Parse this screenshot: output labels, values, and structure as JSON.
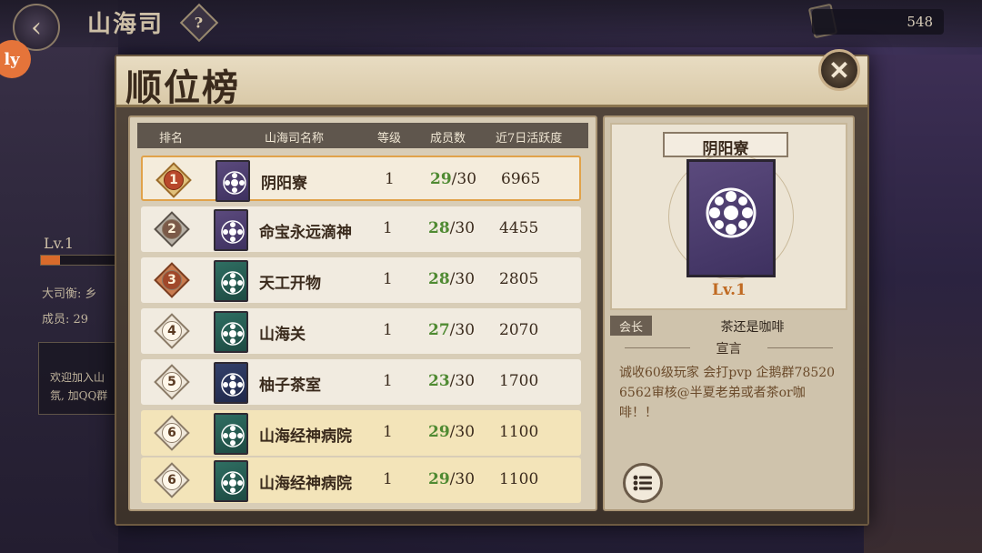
{
  "top_bar": {
    "title": "山海司",
    "help_symbol": "?",
    "currency_value": "548",
    "side_badge": "ly"
  },
  "background_info": {
    "level": "Lv.1",
    "level_progress": 0.25,
    "line1": "大司衡: 乡",
    "line2": "成员: 29",
    "welcome": "欢迎加入山 氛, 加QQ群"
  },
  "window": {
    "title": "顺位榜",
    "close_symbol": "✕"
  },
  "table": {
    "headers": [
      "排名",
      "山海司名称",
      "等级",
      "成员数",
      "近7日活跃度"
    ],
    "rows": [
      {
        "rank": "1",
        "name": "阴阳寮",
        "level": "1",
        "members_current": "29",
        "members_max": "/30",
        "activity": "6965",
        "emblem": "purple"
      },
      {
        "rank": "2",
        "name": "命宝永远滴神",
        "level": "1",
        "members_current": "28",
        "members_max": "/30",
        "activity": "4455",
        "emblem": "purple"
      },
      {
        "rank": "3",
        "name": "天工开物",
        "level": "1",
        "members_current": "28",
        "members_max": "/30",
        "activity": "2805",
        "emblem": "green"
      },
      {
        "rank": "4",
        "name": "山海关",
        "level": "1",
        "members_current": "27",
        "members_max": "/30",
        "activity": "2070",
        "emblem": "green"
      },
      {
        "rank": "5",
        "name": "柚子茶室",
        "level": "1",
        "members_current": "23",
        "members_max": "/30",
        "activity": "1700",
        "emblem": "navy"
      },
      {
        "rank": "6",
        "name": "山海经神病院",
        "level": "1",
        "members_current": "29",
        "members_max": "/30",
        "activity": "1100",
        "emblem": "green"
      },
      {
        "rank": "6",
        "name": "山海经神病院",
        "level": "1",
        "members_current": "29",
        "members_max": "/30",
        "activity": "1100",
        "emblem": "green"
      }
    ]
  },
  "detail": {
    "name": "阴阳寮",
    "level": "Lv.1",
    "leader_label": "会长",
    "leader_name": "茶还是咖啡",
    "announcement_title": "宣言",
    "announcement": "诚收60级玩家 会打pvp 企鹅群785206562审核@半夏老弟或者茶or咖啡！！"
  },
  "colors": {
    "accent_orange": "#c06a22",
    "member_green": "#4f8a32",
    "selected_border": "#e1a24a"
  }
}
